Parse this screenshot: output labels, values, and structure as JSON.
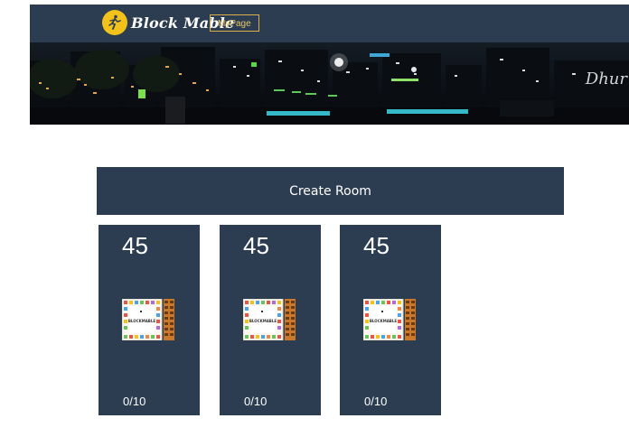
{
  "header": {
    "brand": "Block Mable",
    "mypage_label": "MyPage",
    "logo_icon": "runner-logo-icon",
    "banner_signature": "Dhur"
  },
  "main": {
    "create_room_label": "Create Room",
    "rooms": [
      {
        "number": "45",
        "board_label": "BLOCKMABLE",
        "occupancy": "0/10"
      },
      {
        "number": "45",
        "board_label": "BLOCKMABLE",
        "occupancy": "0/10"
      },
      {
        "number": "45",
        "board_label": "BLOCKMABLE",
        "occupancy": "0/10"
      }
    ]
  },
  "colors": {
    "navy": "#2c3d52",
    "logo_yellow": "#f2c21b",
    "mypage_gold": "#d9b04a"
  }
}
